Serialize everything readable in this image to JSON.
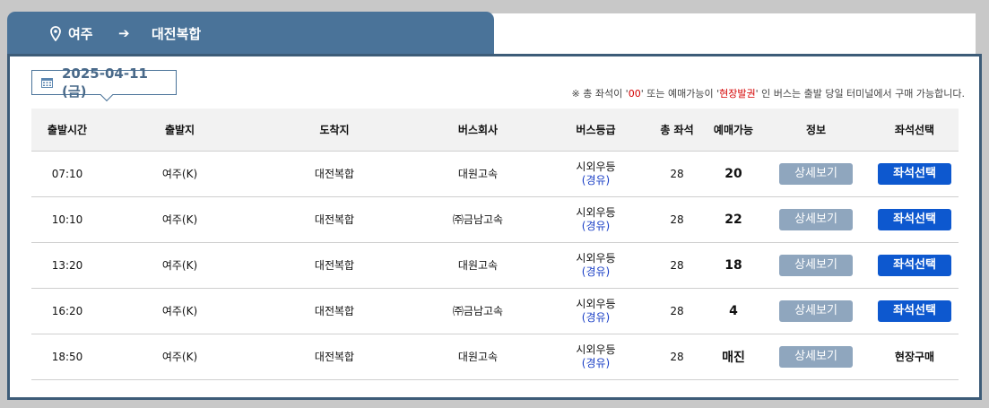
{
  "route": {
    "from": "여주",
    "to": "대전복합"
  },
  "date_label": "2025-04-11 (금)",
  "notice": {
    "part1": "※ 총 좌석이 '",
    "zero": "00",
    "part2": "' 또는 예매가능이 '",
    "onsite": "현장발권",
    "part3": "' 인 버스는 출발 당일 터미널에서 구매 가능합니다."
  },
  "headers": [
    "출발시간",
    "출발지",
    "도착지",
    "버스회사",
    "버스등급",
    "총 좌석",
    "예매가능",
    "정보",
    "좌석선택"
  ],
  "rows": [
    {
      "time": "07:10",
      "origin": "여주(K)",
      "dest": "대전복합",
      "company": "대원고속",
      "grade": "시외우등",
      "via": "(경유)",
      "total": "28",
      "avail": "20",
      "detail": "상세보기",
      "seat": "좌석선택"
    },
    {
      "time": "10:10",
      "origin": "여주(K)",
      "dest": "대전복합",
      "company": "㈜금남고속",
      "grade": "시외우등",
      "via": "(경유)",
      "total": "28",
      "avail": "22",
      "detail": "상세보기",
      "seat": "좌석선택"
    },
    {
      "time": "13:20",
      "origin": "여주(K)",
      "dest": "대전복합",
      "company": "대원고속",
      "grade": "시외우등",
      "via": "(경유)",
      "total": "28",
      "avail": "18",
      "detail": "상세보기",
      "seat": "좌석선택"
    },
    {
      "time": "16:20",
      "origin": "여주(K)",
      "dest": "대전복합",
      "company": "㈜금남고속",
      "grade": "시외우등",
      "via": "(경유)",
      "total": "28",
      "avail": "4",
      "detail": "상세보기",
      "seat": "좌석선택"
    },
    {
      "time": "18:50",
      "origin": "여주(K)",
      "dest": "대전복합",
      "company": "대원고속",
      "grade": "시외우등",
      "via": "(경유)",
      "total": "28",
      "avail": "매진",
      "detail": "상세보기",
      "seat": "현장구매"
    }
  ],
  "icons": {
    "pin": "location-pin-icon",
    "arrow": "arrow-right-icon",
    "calendar": "calendar-icon"
  },
  "colors": {
    "tab": "#4a7399",
    "seat_button": "#0d58cf",
    "detail_button": "#8fa6be",
    "notice_red": "#d40000",
    "via_blue": "#1a3fc6"
  }
}
